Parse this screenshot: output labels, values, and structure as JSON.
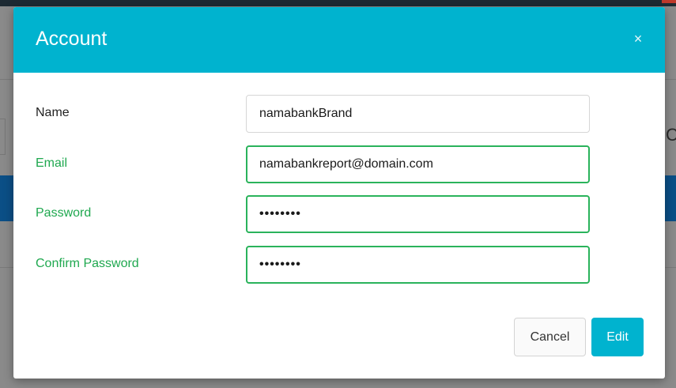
{
  "dialog": {
    "title": "Account",
    "close_icon": "close-icon",
    "close_symbol": "×"
  },
  "form": {
    "fields": [
      {
        "label": "Name",
        "value": "namabankBrand",
        "state": "default"
      },
      {
        "label": "Email",
        "value": "namabankreport@domain.com",
        "state": "valid"
      },
      {
        "label": "Password",
        "value": "••••••••",
        "state": "valid"
      },
      {
        "label": "Confirm Password",
        "value": "••••••••",
        "state": "valid"
      }
    ]
  },
  "buttons": {
    "cancel_label": "Cancel",
    "edit_label": "Edit"
  },
  "colors": {
    "header": "#00b3cf",
    "valid": "#1fa84f",
    "primary_button": "#00b3cf"
  }
}
